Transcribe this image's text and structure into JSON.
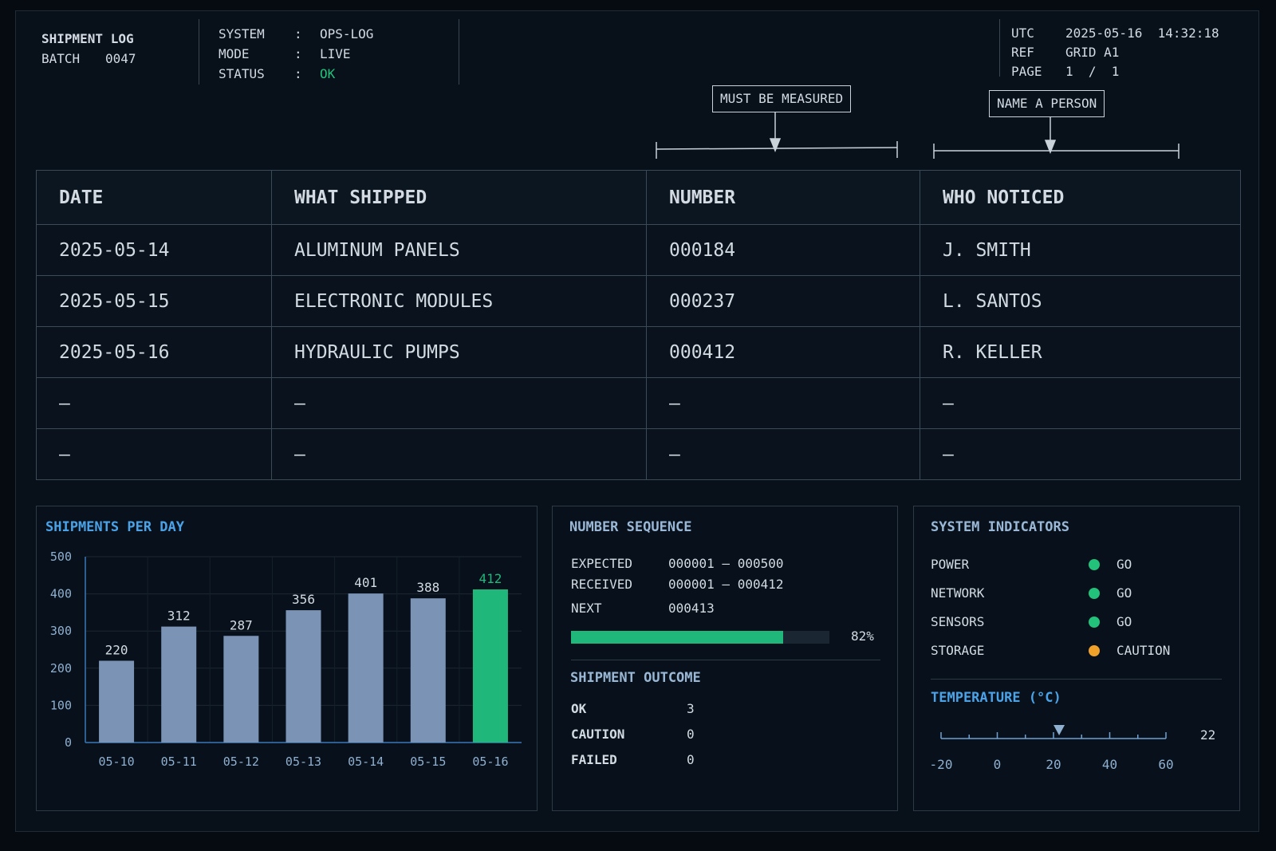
{
  "header": {
    "title": "SHIPMENT LOG",
    "batch_label": "BATCH",
    "batch_value": "0047",
    "system_label": "SYSTEM",
    "system_value": "OPS-LOG",
    "mode_label": "MODE",
    "mode_value": "LIVE",
    "status_label": "STATUS",
    "status_value": "OK",
    "separator": ":",
    "utc_label": "UTC",
    "utc_value": "2025-05-16  14:32:18",
    "ref_label": "REF",
    "ref_value": "GRID A1",
    "page_label": "PAGE",
    "page_value": "1  /  1"
  },
  "annotations": {
    "measured": "MUST BE MEASURED",
    "person": "NAME A PERSON"
  },
  "table": {
    "columns": [
      "DATE",
      "WHAT SHIPPED",
      "NUMBER",
      "WHO NOTICED"
    ],
    "rows": [
      [
        "2025-05-14",
        "ALUMINUM PANELS",
        "000184",
        "J. SMITH"
      ],
      [
        "2025-05-15",
        "ELECTRONIC MODULES",
        "000237",
        "L. SANTOS"
      ],
      [
        "2025-05-16",
        "HYDRAULIC PUMPS",
        "000412",
        "R. KELLER"
      ],
      [
        "–",
        "–",
        "–",
        "–"
      ],
      [
        "–",
        "–",
        "–",
        "–"
      ]
    ]
  },
  "chart_data": {
    "type": "bar",
    "title": "SHIPMENTS PER DAY",
    "categories": [
      "05-10",
      "05-11",
      "05-12",
      "05-13",
      "05-14",
      "05-15",
      "05-16"
    ],
    "values": [
      220,
      312,
      287,
      356,
      401,
      388,
      412
    ],
    "ylim": [
      0,
      500
    ],
    "yticks": [
      0,
      100,
      200,
      300,
      400,
      500
    ],
    "highlight_index": 6,
    "bar_color": "#7b93b4",
    "highlight_color": "#1fb87a",
    "grid": true
  },
  "sequence": {
    "title": "NUMBER SEQUENCE",
    "expected_label": "EXPECTED",
    "expected_value": "000001 – 000500",
    "received_label": "RECEIVED",
    "received_value": "000001 – 000412",
    "next_label": "NEXT",
    "next_value": "000413",
    "progress": 0.82,
    "progress_label": "82%"
  },
  "outcome": {
    "title": "SHIPMENT OUTCOME",
    "items": [
      {
        "label": "OK",
        "value": "3"
      },
      {
        "label": "CAUTION",
        "value": "0"
      },
      {
        "label": "FAILED",
        "value": "0"
      }
    ]
  },
  "indicators": {
    "title": "SYSTEM INDICATORS",
    "items": [
      {
        "label": "POWER",
        "state": "GO",
        "color": "#22c27a"
      },
      {
        "label": "NETWORK",
        "state": "GO",
        "color": "#22c27a"
      },
      {
        "label": "SENSORS",
        "state": "GO",
        "color": "#22c27a"
      },
      {
        "label": "STORAGE",
        "state": "CAUTION",
        "color": "#f0a12a"
      }
    ]
  },
  "temperature": {
    "title": "TEMPERATURE (°C)",
    "value": 22,
    "value_label": "22",
    "range": [
      -20,
      60
    ],
    "ticks": [
      "-20",
      "0",
      "20",
      "40",
      "60"
    ]
  },
  "colors": {
    "ok": "#22c27a",
    "caution": "#f0a12a",
    "failed": "#e04444",
    "accent_blue": "#4aa3e8"
  }
}
